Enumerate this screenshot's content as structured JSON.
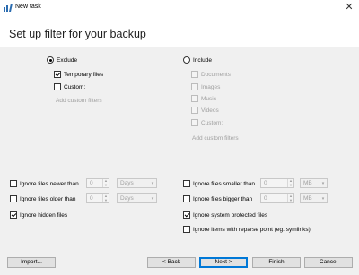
{
  "window": {
    "title": "New task",
    "close_glyph": "✕"
  },
  "header": {
    "title": "Set up filter for your backup"
  },
  "exclude": {
    "label": "Exclude",
    "selected": true,
    "options": [
      {
        "label": "Temporary files",
        "checked": true
      },
      {
        "label": "Custom:",
        "checked": false
      }
    ],
    "add_link": "Add custom filters"
  },
  "include": {
    "label": "Include",
    "selected": false,
    "options": [
      {
        "label": "Documents",
        "checked": false
      },
      {
        "label": "Images",
        "checked": false
      },
      {
        "label": "Music",
        "checked": false
      },
      {
        "label": "Videos",
        "checked": false
      },
      {
        "label": "Custom:",
        "checked": false
      }
    ],
    "add_link": "Add custom filters"
  },
  "filters": {
    "newer": {
      "label": "Ignore files newer than",
      "checked": false,
      "value": "0",
      "unit": "Days"
    },
    "older": {
      "label": "Ignore files older than",
      "checked": false,
      "value": "0",
      "unit": "Days"
    },
    "hidden": {
      "label": "Ignore hidden files",
      "checked": true
    },
    "smaller": {
      "label": "Ignore files smaller than",
      "checked": false,
      "value": "0",
      "unit": "MB"
    },
    "bigger": {
      "label": "Ignore files bigger than",
      "checked": false,
      "value": "0",
      "unit": "MB"
    },
    "system": {
      "label": "Ignore system protected files",
      "checked": true
    },
    "reparse": {
      "label": "Ignore items with reparse point (eg. symlinks)",
      "checked": false
    }
  },
  "buttons": {
    "import": "Import...",
    "back": "< Back",
    "next": "Next >",
    "finish": "Finish",
    "cancel": "Cancel"
  },
  "colors": {
    "accent": "#0078d7",
    "disabled_text": "#a0a0a0",
    "app_icon": "#2b6cb0"
  },
  "icons": {
    "app": "backup-app-icon",
    "close": "close-icon",
    "spin_up": "▲",
    "spin_down": "▼",
    "caret": "▾"
  }
}
